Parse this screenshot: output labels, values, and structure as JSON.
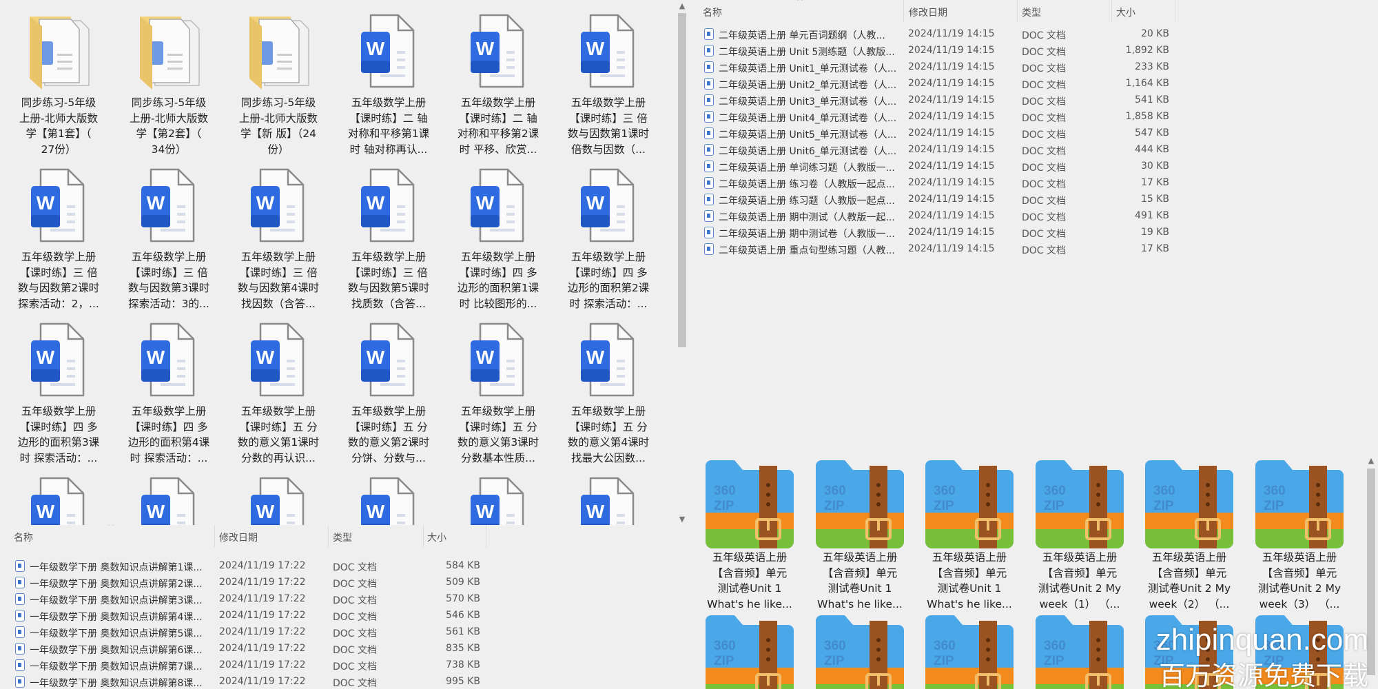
{
  "top_left_grid": {
    "items": [
      {
        "type": "folder",
        "lines": [
          "同步练习-5年级",
          "上册-北师大版数",
          "学【第1套】（",
          "27份）"
        ]
      },
      {
        "type": "folder",
        "lines": [
          "同步练习-5年级",
          "上册-北师大版数",
          "学【第2套】（",
          "34份）"
        ]
      },
      {
        "type": "folder",
        "lines": [
          "同步练习-5年级",
          "上册-北师大版数",
          "学【新 版】（24",
          "份）"
        ]
      },
      {
        "type": "word",
        "lines": [
          "五年级数学上册",
          "【课时练】二 轴",
          "对称和平移第1课",
          "时  轴对称再认..."
        ]
      },
      {
        "type": "word",
        "lines": [
          "五年级数学上册",
          "【课时练】二 轴",
          "对称和平移第2课",
          "时  平移、欣赏..."
        ]
      },
      {
        "type": "word",
        "lines": [
          "五年级数学上册",
          "【课时练】三 倍",
          "数与因数第1课时",
          "倍数与因数（..."
        ]
      },
      {
        "type": "word",
        "lines": [
          "五年级数学上册",
          "【课时练】三 倍",
          "数与因数第2课时",
          "探索活动：2，..."
        ]
      },
      {
        "type": "word",
        "lines": [
          "五年级数学上册",
          "【课时练】三 倍",
          "数与因数第3课时",
          "探索活动：3的..."
        ]
      },
      {
        "type": "word",
        "lines": [
          "五年级数学上册",
          "【课时练】三 倍",
          "数与因数第4课时",
          "找因数（含答..."
        ]
      },
      {
        "type": "word",
        "lines": [
          "五年级数学上册",
          "【课时练】三 倍",
          "数与因数第5课时",
          "找质数（含答..."
        ]
      },
      {
        "type": "word",
        "lines": [
          "五年级数学上册",
          "【课时练】四 多",
          "边形的面积第1课",
          "时  比较图形的..."
        ]
      },
      {
        "type": "word",
        "lines": [
          "五年级数学上册",
          "【课时练】四 多",
          "边形的面积第2课",
          "时  探索活动：..."
        ]
      },
      {
        "type": "word",
        "lines": [
          "五年级数学上册",
          "【课时练】四 多",
          "边形的面积第3课",
          "时  探索活动：..."
        ]
      },
      {
        "type": "word",
        "lines": [
          "五年级数学上册",
          "【课时练】四 多",
          "边形的面积第4课",
          "时  探索活动：..."
        ]
      },
      {
        "type": "word",
        "lines": [
          "五年级数学上册",
          "【课时练】五 分",
          "数的意义第1课时",
          "分数的再认识..."
        ]
      },
      {
        "type": "word",
        "lines": [
          "五年级数学上册",
          "【课时练】五 分",
          "数的意义第2课时",
          "分饼、分数与..."
        ]
      },
      {
        "type": "word",
        "lines": [
          "五年级数学上册",
          "【课时练】五 分",
          "数的意义第3课时",
          "分数基本性质..."
        ]
      },
      {
        "type": "word",
        "lines": [
          "五年级数学上册",
          "【课时练】五 分",
          "数的意义第4课时",
          "找最大公因数..."
        ]
      },
      {
        "type": "word",
        "lines": []
      },
      {
        "type": "word",
        "lines": []
      },
      {
        "type": "word",
        "lines": []
      },
      {
        "type": "word",
        "lines": []
      },
      {
        "type": "word",
        "lines": []
      },
      {
        "type": "word",
        "lines": []
      }
    ]
  },
  "columns": {
    "name": "名称",
    "date": "修改日期",
    "type": "类型",
    "size": "大小"
  },
  "bottom_left_list": {
    "rows": [
      {
        "name": "一年级数学下册  奥数知识点讲解第1课...",
        "date": "2024/11/19 17:22",
        "type": "DOC 文档",
        "size": "584 KB"
      },
      {
        "name": "一年级数学下册  奥数知识点讲解第2课...",
        "date": "2024/11/19 17:22",
        "type": "DOC 文档",
        "size": "509 KB"
      },
      {
        "name": "一年级数学下册  奥数知识点讲解第3课...",
        "date": "2024/11/19 17:22",
        "type": "DOC 文档",
        "size": "570 KB"
      },
      {
        "name": "一年级数学下册  奥数知识点讲解第4课...",
        "date": "2024/11/19 17:22",
        "type": "DOC 文档",
        "size": "546 KB"
      },
      {
        "name": "一年级数学下册  奥数知识点讲解第5课...",
        "date": "2024/11/19 17:22",
        "type": "DOC 文档",
        "size": "561 KB"
      },
      {
        "name": "一年级数学下册  奥数知识点讲解第6课...",
        "date": "2024/11/19 17:22",
        "type": "DOC 文档",
        "size": "835 KB"
      },
      {
        "name": "一年级数学下册  奥数知识点讲解第7课...",
        "date": "2024/11/19 17:22",
        "type": "DOC 文档",
        "size": "738 KB"
      },
      {
        "name": "一年级数学下册  奥数知识点讲解第8课...",
        "date": "2024/11/19 17:22",
        "type": "DOC 文档",
        "size": "995 KB"
      }
    ]
  },
  "top_right_list": {
    "rows": [
      {
        "name": "二年级英语上册    单元百词题纲（人教...",
        "date": "2024/11/19 14:15",
        "type": "DOC 文档",
        "size": "20 KB"
      },
      {
        "name": "二年级英语上册  Unit 5测练题（人教版...",
        "date": "2024/11/19 14:15",
        "type": "DOC 文档",
        "size": "1,892 KB"
      },
      {
        "name": "二年级英语上册  Unit1_单元测试卷（人...",
        "date": "2024/11/19 14:15",
        "type": "DOC 文档",
        "size": "233 KB"
      },
      {
        "name": "二年级英语上册  Unit2_单元测试卷（人...",
        "date": "2024/11/19 14:15",
        "type": "DOC 文档",
        "size": "1,164 KB"
      },
      {
        "name": "二年级英语上册  Unit3_单元测试卷（人...",
        "date": "2024/11/19 14:15",
        "type": "DOC 文档",
        "size": "541 KB"
      },
      {
        "name": "二年级英语上册  Unit4_单元测试卷（人...",
        "date": "2024/11/19 14:15",
        "type": "DOC 文档",
        "size": "1,858 KB"
      },
      {
        "name": "二年级英语上册  Unit5_单元测试卷（人...",
        "date": "2024/11/19 14:15",
        "type": "DOC 文档",
        "size": "547 KB"
      },
      {
        "name": "二年级英语上册  Unit6_单元测试卷（人...",
        "date": "2024/11/19 14:15",
        "type": "DOC 文档",
        "size": "444 KB"
      },
      {
        "name": "二年级英语上册  单词练习题（人教版一...",
        "date": "2024/11/19 14:15",
        "type": "DOC 文档",
        "size": "30 KB"
      },
      {
        "name": "二年级英语上册  练习卷（人教版一起点...",
        "date": "2024/11/19 14:15",
        "type": "DOC 文档",
        "size": "17 KB"
      },
      {
        "name": "二年级英语上册  练习题（人教版一起点...",
        "date": "2024/11/19 14:15",
        "type": "DOC 文档",
        "size": "15 KB"
      },
      {
        "name": "二年级英语上册  期中测试（人教版一起...",
        "date": "2024/11/19 14:15",
        "type": "DOC 文档",
        "size": "491 KB"
      },
      {
        "name": "二年级英语上册  期中测试卷（人教版一...",
        "date": "2024/11/19 14:15",
        "type": "DOC 文档",
        "size": "19 KB"
      },
      {
        "name": "二年级英语上册  重点句型练习题（人教...",
        "date": "2024/11/19 14:15",
        "type": "DOC 文档",
        "size": "17 KB"
      }
    ]
  },
  "bottom_right_grid": {
    "zip_text": [
      "360",
      "ZIP"
    ],
    "items": [
      {
        "lines": [
          "五年级英语上册",
          "【含音频】单元",
          "测试卷Unit 1",
          "What's he like..."
        ]
      },
      {
        "lines": [
          "五年级英语上册",
          "【含音频】单元",
          "测试卷Unit 1",
          "What's he like..."
        ]
      },
      {
        "lines": [
          "五年级英语上册",
          "【含音频】单元",
          "测试卷Unit 1",
          "What's he like..."
        ]
      },
      {
        "lines": [
          "五年级英语上册",
          "【含音频】单元",
          "测试卷Unit 2 My",
          "week（1）  （..."
        ]
      },
      {
        "lines": [
          "五年级英语上册",
          "【含音频】单元",
          "测试卷Unit 2 My",
          "week（2）  （..."
        ]
      },
      {
        "lines": [
          "五年级英语上册",
          "【含音频】单元",
          "测试卷Unit 2 My",
          "week（3）  （..."
        ]
      },
      {
        "lines": []
      },
      {
        "lines": []
      },
      {
        "lines": []
      },
      {
        "lines": []
      },
      {
        "lines": []
      },
      {
        "lines": []
      }
    ]
  },
  "watermark": {
    "line1": "zhipinquan.com",
    "line2": "百万资源免费下载"
  },
  "colors": {
    "word_blue": "#2e6be0",
    "folder_yellow": "#f3d27a",
    "zip_blue": "#4aa8e8",
    "zip_orange": "#f28a1c",
    "zip_green": "#78c03a",
    "strap": "#9b5322"
  }
}
